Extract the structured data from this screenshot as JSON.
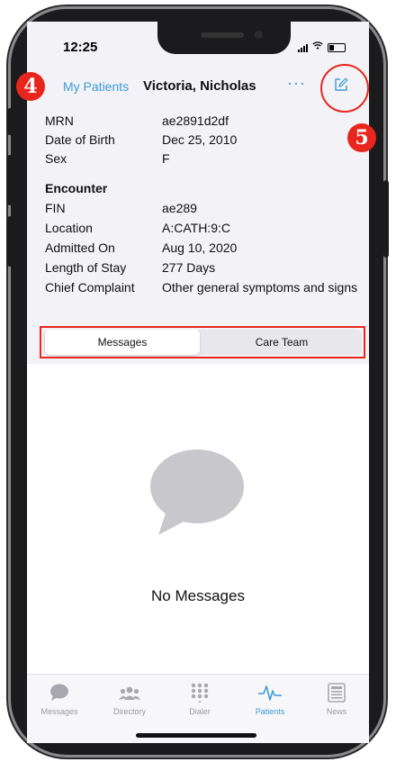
{
  "status_bar": {
    "time": "12:25"
  },
  "nav": {
    "back_label": "My Patients",
    "title": "Victoria, Nicholas",
    "more": "···"
  },
  "annotations": {
    "step4": "4",
    "step5": "5"
  },
  "patient": {
    "rows": [
      {
        "label": "MRN",
        "value": "ae2891d2df"
      },
      {
        "label": "Date of Birth",
        "value": "Dec 25, 2010"
      },
      {
        "label": "Sex",
        "value": "F"
      }
    ]
  },
  "encounter": {
    "heading": "Encounter",
    "rows": [
      {
        "label": "FIN",
        "value": "ae289"
      },
      {
        "label": "Location",
        "value": "A:CATH:9:C"
      },
      {
        "label": "Admitted On",
        "value": "Aug 10, 2020"
      },
      {
        "label": "Length of Stay",
        "value": "277 Days"
      },
      {
        "label": "Chief Complaint",
        "value": "Other general symptoms and signs"
      }
    ]
  },
  "segments": {
    "messages": "Messages",
    "care_team": "Care Team",
    "selected": "Messages"
  },
  "empty_state": {
    "text": "No Messages"
  },
  "tabs": [
    {
      "label": "Messages",
      "icon": "chat-bubble-icon"
    },
    {
      "label": "Directory",
      "icon": "people-icon"
    },
    {
      "label": "Dialer",
      "icon": "keypad-icon"
    },
    {
      "label": "Patients",
      "icon": "heartbeat-icon",
      "active": true
    },
    {
      "label": "News",
      "icon": "news-icon"
    }
  ],
  "colors": {
    "accent": "#3d9bd6",
    "annotation": "#e8261d",
    "header_bg": "#f2f2f7"
  }
}
